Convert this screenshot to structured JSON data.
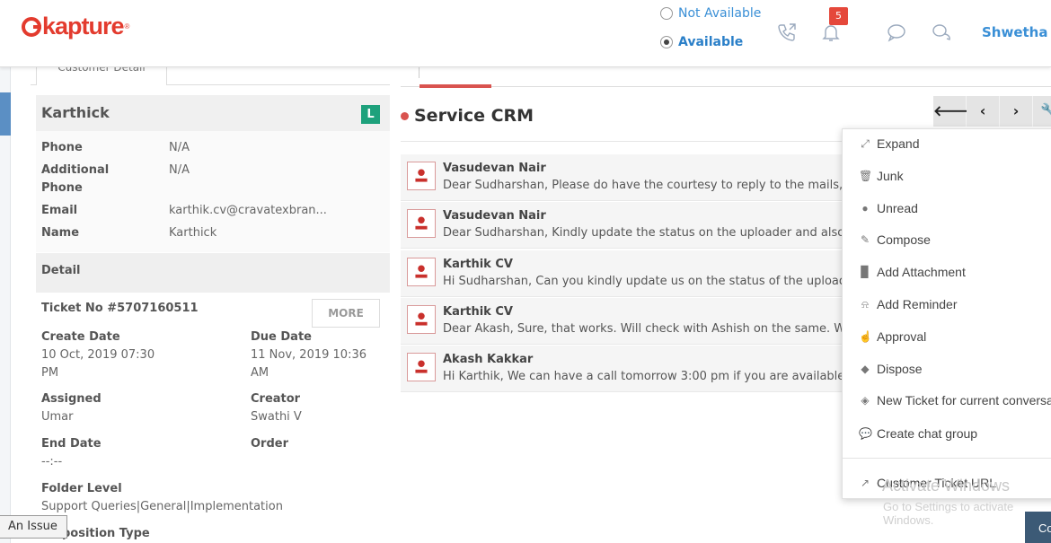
{
  "header": {
    "logo_text": "kapture",
    "logo_mark": "®",
    "status_not_available": "Not Available",
    "status_available": "Available",
    "notification_count": "5",
    "user_name": "Shwetha T"
  },
  "left_panel": {
    "tab_label": "Customer Detail",
    "customer_name": "Karthick",
    "level_badge": "L",
    "level_badge_color": "#1ea17c",
    "fields": [
      {
        "label": "Phone",
        "value": "N/A"
      },
      {
        "label": "Additional Phone",
        "value": "N/A"
      },
      {
        "label": "Email",
        "value": "karthik.cv@cravatexbran..."
      },
      {
        "label": "Name",
        "value": "Karthick"
      }
    ],
    "detail_title": "Detail",
    "ticket_label": "Ticket No #5707160511",
    "more_button": "MORE",
    "create_date_label": "Create Date",
    "create_date_value": "10 Oct, 2019 07:30 PM",
    "due_date_label": "Due Date",
    "due_date_value": "11 Nov, 2019 10:36 AM",
    "assigned_label": "Assigned",
    "assigned_value": "Umar",
    "creator_label": "Creator",
    "creator_value": "Swathi V",
    "end_date_label": "End Date",
    "end_date_value": "--:--",
    "order_label": "Order",
    "folder_level_label": "Folder Level",
    "folder_level_value": "Support Queries|General|Implementation",
    "disposition_label": "Disposition Type"
  },
  "issue_tab": "An Issue",
  "main": {
    "title": "Service CRM",
    "nav_buttons": [
      "🡐",
      "‹",
      "›",
      "🔧"
    ],
    "messages": [
      {
        "sender": "Vasudevan Nair",
        "text": "Dear Sudharshan, Please do have the courtesy to reply to the mails, we have been"
      },
      {
        "sender": "Vasudevan Nair",
        "text": "Dear Sudharshan,  Kindly update the status on the uploader and also help us"
      },
      {
        "sender": "Karthik CV",
        "text": "Hi Sudharshan, Can you kindly update us on the status of the uploader and a"
      },
      {
        "sender": "Karthik CV",
        "text": "Dear Akash, Sure, that works. Will check with Ashish on the same. Will keep you"
      },
      {
        "sender": "Akash Kakkar",
        "text": "Hi Karthik, We can have a call tomorrow 3:00 pm if you are available, please share"
      }
    ]
  },
  "dropdown": {
    "items": [
      {
        "label": "Expand",
        "icon": "expand-icon"
      },
      {
        "label": "Junk",
        "icon": "trash-icon"
      },
      {
        "label": "Unread",
        "icon": "circle-icon"
      },
      {
        "label": "Compose",
        "icon": "edit-icon"
      },
      {
        "label": "Add Attachment",
        "icon": "file-icon"
      },
      {
        "label": "Add Reminder",
        "icon": "bell-icon"
      },
      {
        "label": "Approval",
        "icon": "thumbs-up-icon"
      },
      {
        "label": "Dispose",
        "icon": "tag-icon"
      },
      {
        "label": "New Ticket for current conversation",
        "icon": "ticket-icon"
      },
      {
        "label": "Create chat group",
        "icon": "chat-icon"
      },
      {
        "label": "Customer Ticket URL",
        "icon": "external-link-icon"
      }
    ]
  },
  "watermark": {
    "line1": "Activate Windows",
    "line2": "Go to Settings to activate Windows."
  },
  "bottom_button": "Co"
}
